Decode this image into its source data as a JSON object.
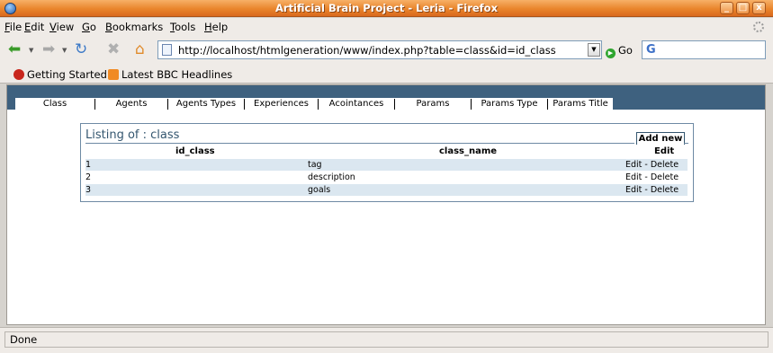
{
  "window": {
    "title": "Artificial Brain Project - Leria - Firefox",
    "buttons": {
      "minimize": "_",
      "maximize": "□",
      "close": "x"
    }
  },
  "menu": [
    {
      "underline": "F",
      "rest": "ile"
    },
    {
      "underline": "E",
      "rest": "dit"
    },
    {
      "underline": "V",
      "rest": "iew"
    },
    {
      "underline": "G",
      "rest": "o"
    },
    {
      "underline": "B",
      "rest": "ookmarks"
    },
    {
      "underline": "T",
      "rest": "ools"
    },
    {
      "underline": "H",
      "rest": "elp"
    }
  ],
  "toolbar": {
    "url": "http://localhost/htmlgeneration/www/index.php?table=class&id=id_class",
    "go_label": "Go",
    "search_engine_glyph": "G"
  },
  "bookmarks": {
    "items": [
      "Getting Started",
      "Latest BBC Headlines"
    ]
  },
  "tabs": [
    "Class",
    "Agents",
    "Agents Types",
    "Experiences",
    "Acointances",
    "Params",
    "Params Type",
    "Params Title"
  ],
  "listing": {
    "title": "Listing of : class",
    "add_new": "Add new",
    "headers": {
      "id": "id_class",
      "name": "class_name",
      "edit": "Edit"
    },
    "rows": [
      {
        "id": "1",
        "name": "tag",
        "actions": "Edit - Delete"
      },
      {
        "id": "2",
        "name": "description",
        "actions": "Edit - Delete"
      },
      {
        "id": "3",
        "name": "goals",
        "actions": "Edit - Delete"
      }
    ]
  },
  "status": {
    "text": "Done"
  },
  "colors": {
    "titlebar": "#e9852c",
    "band": "#3e617f",
    "row_alt": "#dbe7f0",
    "listing_title": "#34566f"
  }
}
